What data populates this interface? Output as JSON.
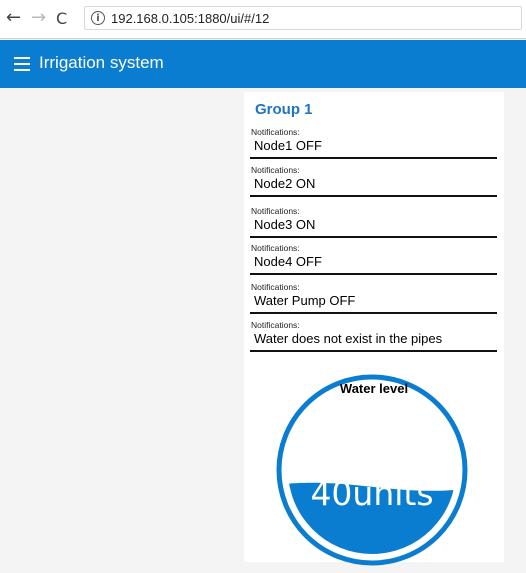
{
  "browser": {
    "back_icon": "←",
    "forward_icon": "→",
    "reload_icon": "C",
    "info_icon": "i",
    "url": "192.168.0.105:1880/ui/#/12"
  },
  "header": {
    "title": "Irrigation system"
  },
  "group": {
    "title": "Group 1",
    "notifications": [
      {
        "label": "Notifications:",
        "value": "Node1 OFF"
      },
      {
        "label": "Notifications:",
        "value": "Node2 ON"
      },
      {
        "label": "Notifications:",
        "value": "Node3 ON"
      },
      {
        "label": "Notifications:",
        "value": "Node4 OFF"
      },
      {
        "label": "Notifications:",
        "value": "Water Pump OFF"
      },
      {
        "label": "Notifications:",
        "value": "Water does not exist in the pipes"
      }
    ]
  },
  "gauge": {
    "title": "Water level",
    "value_text": "40units",
    "level": 0.4,
    "color": "#0b7dd1"
  }
}
